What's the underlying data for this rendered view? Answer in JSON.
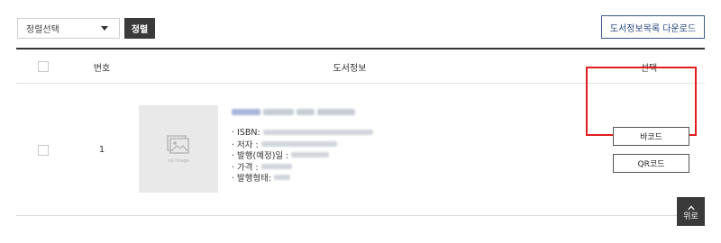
{
  "toolbar": {
    "sort_select_value": "정렬선택",
    "sort_button": "정렬",
    "download_button": "도서정보목록 다운로드"
  },
  "table": {
    "headers": {
      "number": "번호",
      "info": "도서정보",
      "select": "선택"
    },
    "rows": [
      {
        "number": "1",
        "thumbnail_text": "no image",
        "fields": [
          {
            "label": "· ISBN:"
          },
          {
            "label": "· 저자 :"
          },
          {
            "label": "· 발행(예정)일 :"
          },
          {
            "label": "· 가격 :"
          },
          {
            "label": "· 발행형태:"
          }
        ],
        "actions": {
          "barcode": "바코드",
          "qrcode": "QR코드"
        }
      }
    ]
  },
  "top_button": "위로",
  "colors": {
    "dark_button": "#3a3a3a",
    "download_border": "#3a5a8c",
    "highlight": "#e01c1c"
  }
}
